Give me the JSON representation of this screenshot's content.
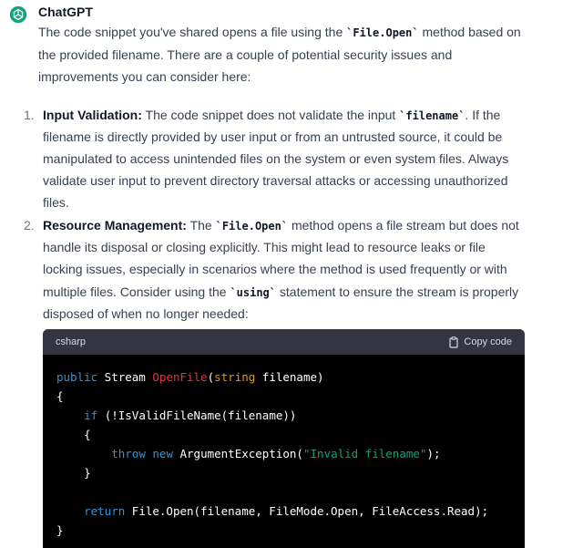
{
  "message": {
    "author": "ChatGPT",
    "intro_lines": [
      [
        "The code snippet you've shared opens a file using the ",
        "`File.Open`",
        " method based on"
      ],
      [
        "the provided filename. There are a couple of potential security issues and"
      ],
      [
        "improvements you can consider here:"
      ]
    ],
    "items": [
      {
        "number": "1.",
        "title": "Input Validation:",
        "line1_rest_a": " The code snippet does not validate the input ",
        "line1_code": "`filename`",
        "line1_rest_b": ". If the",
        "lines": [
          "filename is directly provided by user input or from an untrusted source, it could be",
          "manipulated to access unintended files on the system or even system files. Always",
          "validate user input to prevent directory traversal attacks or accessing unauthorized",
          "files."
        ]
      },
      {
        "number": "2.",
        "title": "Resource Management:",
        "line1_rest_a": " The ",
        "line1_code": "`File.Open`",
        "line1_rest_b": " method opens a file stream but does not",
        "lines": [
          "handle its disposal or closing explicitly. This might lead to resource leaks or file",
          "locking issues, especially in scenarios where the method is used frequently or with"
        ],
        "line4_a": "multiple files. Consider using the ",
        "line4_code": "`using`",
        "line4_b": " statement to ensure the stream is properly",
        "line5": "disposed of when no longer needed:"
      }
    ],
    "code": {
      "language": "csharp",
      "copy_label": "Copy code",
      "lines": [
        [
          [
            "public",
            "kw"
          ],
          [
            " Stream ",
            ""
          ],
          [
            "OpenFile",
            "fn"
          ],
          [
            "(",
            ""
          ],
          [
            "string",
            "ty"
          ],
          [
            " filename)",
            ""
          ]
        ],
        [
          [
            "{",
            ""
          ]
        ],
        [
          [
            "    ",
            ""
          ],
          [
            "if",
            "kw"
          ],
          [
            " (!IsValidFileName(filename))",
            ""
          ]
        ],
        [
          [
            "    {",
            ""
          ]
        ],
        [
          [
            "        ",
            ""
          ],
          [
            "throw",
            "kw"
          ],
          [
            " ",
            ""
          ],
          [
            "new",
            "kw"
          ],
          [
            " ArgumentException(",
            ""
          ],
          [
            "\"Invalid filename\"",
            "st"
          ],
          [
            ");",
            ""
          ]
        ],
        [
          [
            "    }",
            ""
          ]
        ],
        [
          [
            "",
            ""
          ]
        ],
        [
          [
            "    ",
            ""
          ],
          [
            "return",
            "kw"
          ],
          [
            " File.Open(filename, FileMode.Open, FileAccess.Read);",
            ""
          ]
        ],
        [
          [
            "}",
            ""
          ]
        ]
      ]
    }
  }
}
